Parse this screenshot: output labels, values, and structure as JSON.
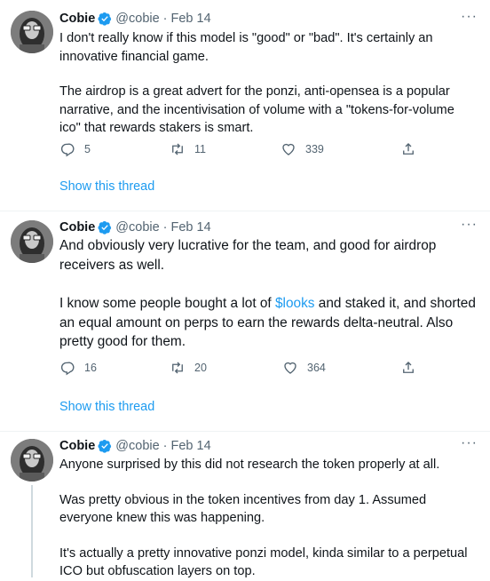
{
  "tweets": [
    {
      "name": "Cobie",
      "handle": "@cobie",
      "dot": "·",
      "date": "Feb 14",
      "paragraphs": [
        "I don't really know if this model is \"good\" or \"bad\". It's certainly an innovative financial game.",
        "The airdrop is a great advert for the ponzi, anti-opensea is a popular narrative, and the incentivisation of volume with a  \"tokens-for-volume ico\" that rewards stakers is smart."
      ],
      "replies": "5",
      "retweets": "11",
      "likes": "339",
      "show_thread": "Show this thread"
    },
    {
      "name": "Cobie",
      "handle": "@cobie",
      "dot": "·",
      "date": "Feb 14",
      "p1": "And obviously very lucrative for the team, and good for airdrop receivers as well.",
      "p2_before": "I know some people bought a lot of ",
      "p2_cashtag": "$looks",
      "p2_after": " and staked it, and shorted an equal amount on perps to earn the rewards delta-neutral. Also pretty good for them.",
      "replies": "16",
      "retweets": "20",
      "likes": "364",
      "show_thread": "Show this thread"
    },
    {
      "name": "Cobie",
      "handle": "@cobie",
      "dot": "·",
      "date": "Feb 14",
      "paragraphs": [
        "Anyone surprised by this did not research the token properly at all.",
        "Was pretty obvious in the token incentives from day 1. Assumed everyone knew this was happening.",
        "It's actually a pretty innovative ponzi model, kinda similar to a perpetual ICO but obfuscation layers on top."
      ]
    }
  ],
  "more_label": "···",
  "colors": {
    "accent": "#1d9bf0",
    "secondary_text": "#536471",
    "verified": "#1d9bf0"
  },
  "icons": [
    "verified-badge-icon",
    "reply-icon",
    "retweet-icon",
    "like-icon",
    "share-icon",
    "more-icon"
  ]
}
